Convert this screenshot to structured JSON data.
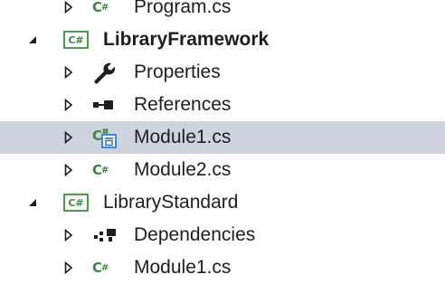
{
  "solution_explorer": {
    "items": [
      {
        "label": "Program.cs",
        "icon": "csharp-file-icon",
        "level": 1,
        "expander": "collapsed"
      },
      {
        "label": "LibraryFramework",
        "icon": "csharp-project-icon",
        "level": 0,
        "expander": "expanded",
        "bold": true
      },
      {
        "label": "Properties",
        "icon": "wrench-icon",
        "level": 1,
        "expander": "collapsed"
      },
      {
        "label": "References",
        "icon": "references-icon",
        "level": 1,
        "expander": "collapsed"
      },
      {
        "label": "Module1.cs",
        "icon": "csharp-module-file-icon",
        "level": 1,
        "expander": "collapsed",
        "selected": true
      },
      {
        "label": "Module2.cs",
        "icon": "csharp-file-icon",
        "level": 1,
        "expander": "collapsed"
      },
      {
        "label": "LibraryStandard",
        "icon": "csharp-project-icon",
        "level": 0,
        "expander": "expanded"
      },
      {
        "label": "Dependencies",
        "icon": "dependencies-icon",
        "level": 1,
        "expander": "collapsed"
      },
      {
        "label": "Module1.cs",
        "icon": "csharp-file-icon",
        "level": 1,
        "expander": "collapsed"
      }
    ],
    "icon_glyphs": {
      "csharp": "C#",
      "project": "C#"
    },
    "colors": {
      "selection": "#cfd3de",
      "csharp_green": "#3a8a3a",
      "text": "#1e1e1e"
    }
  }
}
